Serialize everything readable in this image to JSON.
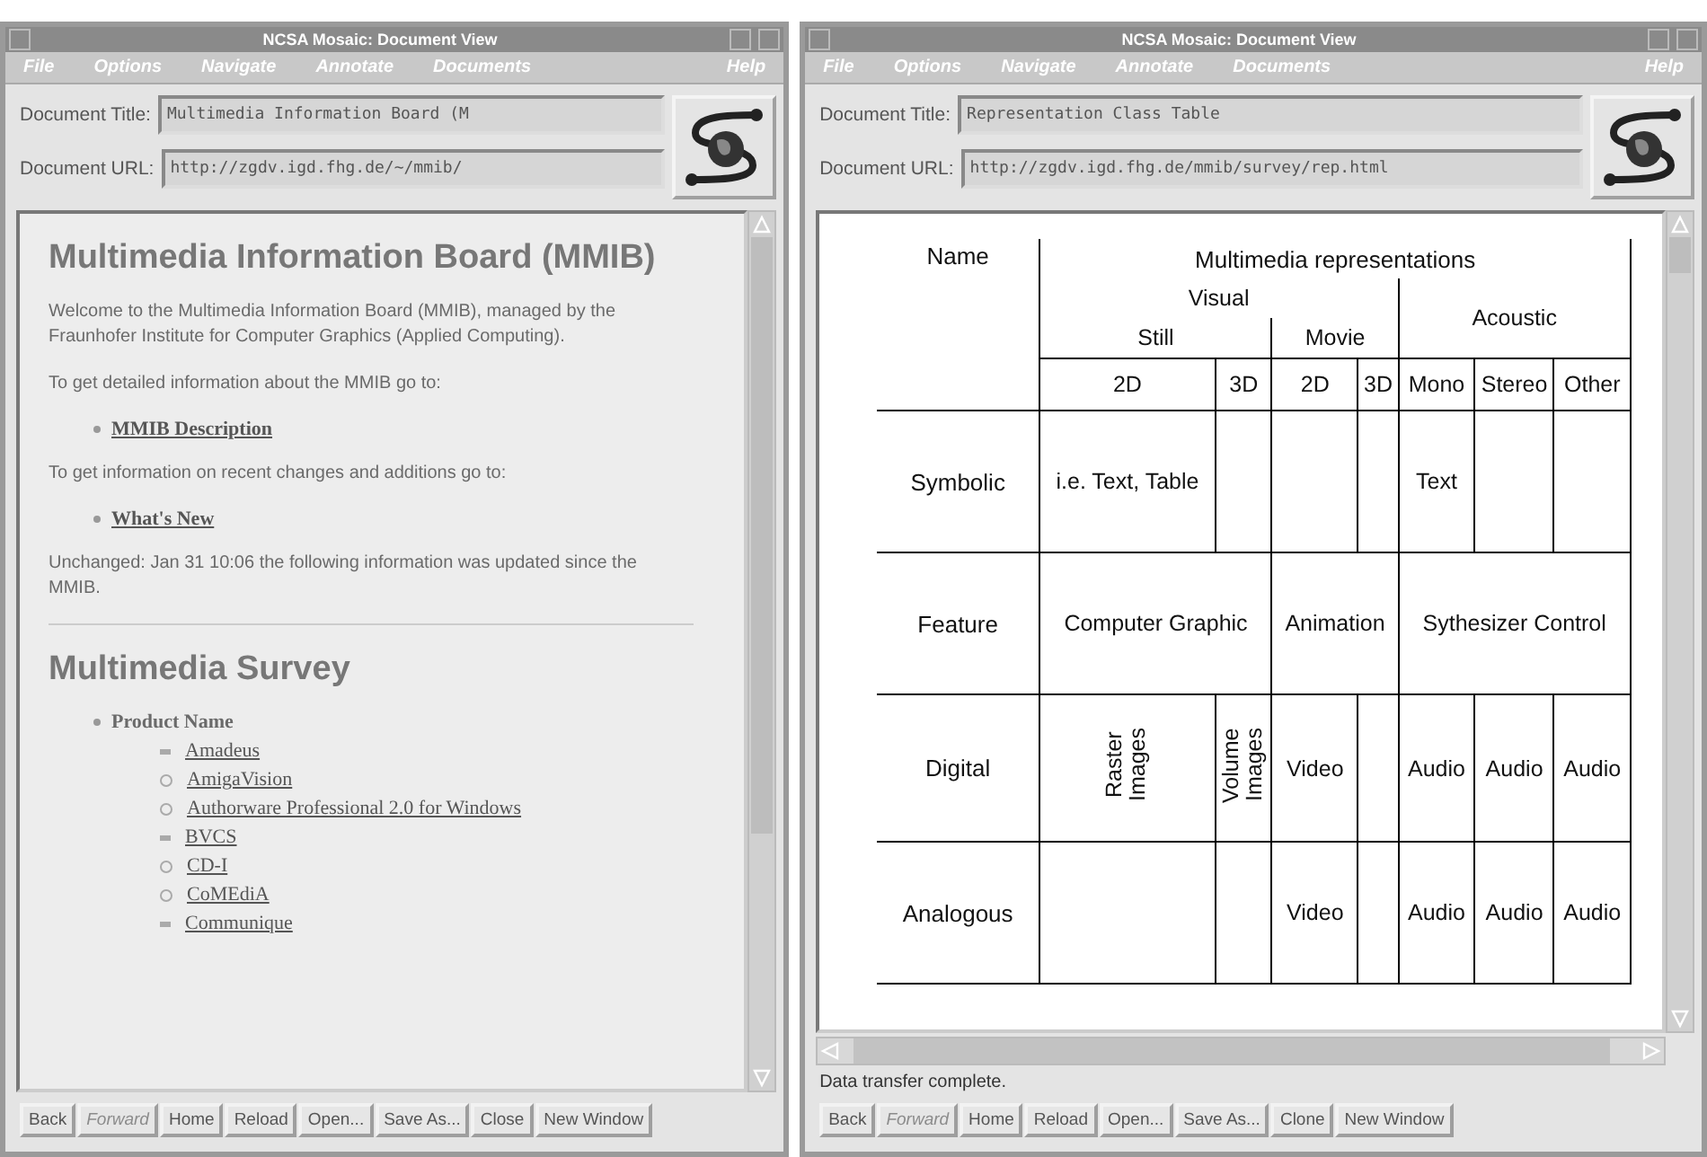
{
  "windows": [
    {
      "title": "NCSA Mosaic: Document View",
      "menu": [
        {
          "label": "File"
        },
        {
          "label": "Options"
        },
        {
          "label": "Navigate"
        },
        {
          "label": "Annotate"
        },
        {
          "label": "Documents"
        },
        {
          "label": "Help"
        }
      ],
      "title_label": "Document Title:",
      "document_title": "Multimedia Information Board (M",
      "url_label": "Document URL:",
      "document_url": "http://zgdv.igd.fhg.de/~/mmib/",
      "content": {
        "kind": "page",
        "heading": "Multimedia Information Board (MMIB)",
        "blocks": [
          {
            "kind": "para",
            "text": "Welcome to the Multimedia Information Board (MMIB), managed by the Fraunhofer Institute for Computer Graphics (Applied Computing)."
          },
          {
            "kind": "para",
            "text": "To get detailed information about the MMIB go to:"
          },
          {
            "kind": "link",
            "text": "MMIB Description"
          },
          {
            "kind": "para",
            "text": "To get information on recent changes and additions go to:"
          },
          {
            "kind": "link",
            "text": "What's New"
          },
          {
            "kind": "para",
            "text": "Unchanged: Jan 31 10:06 the following information was updated since the MMIB."
          },
          {
            "kind": "rule"
          },
          {
            "kind": "heading",
            "text": "Multimedia Survey"
          },
          {
            "kind": "list",
            "text": "Product Name",
            "items": [
              {
                "kind": "square",
                "text": "Amadeus"
              },
              {
                "kind": "circle",
                "text": "AmigaVision"
              },
              {
                "kind": "circle",
                "text": "Authorware Professional 2.0 for Windows"
              },
              {
                "kind": "square",
                "text": "BVCS"
              },
              {
                "kind": "circle",
                "text": "CD-I"
              },
              {
                "kind": "circle",
                "text": "CoMEdiA"
              },
              {
                "kind": "square",
                "text": "Communique"
              }
            ]
          }
        ]
      },
      "buttons": [
        {
          "label": "Back",
          "disabled": false
        },
        {
          "label": "Forward",
          "disabled": true
        },
        {
          "label": "Home",
          "disabled": false
        },
        {
          "label": "Reload",
          "disabled": false
        },
        {
          "label": "Open...",
          "disabled": false
        },
        {
          "label": "Save As...",
          "disabled": false
        },
        {
          "label": "Close",
          "disabled": false
        },
        {
          "label": "New Window",
          "disabled": false
        }
      ]
    },
    {
      "title": "NCSA Mosaic: Document View",
      "menu": [
        {
          "label": "File"
        },
        {
          "label": "Options"
        },
        {
          "label": "Navigate"
        },
        {
          "label": "Annotate"
        },
        {
          "label": "Documents"
        },
        {
          "label": "Help"
        }
      ],
      "title_label": "Document Title:",
      "document_title": "Representation Class Table",
      "url_label": "Document URL:",
      "document_url": "http://zgdv.igd.fhg.de/mmib/survey/rep.html",
      "content": {
        "kind": "table",
        "header": [
          [
            {
              "text": "Name",
              "rowspan": 4
            },
            {
              "text": "Multimedia representations",
              "colspan": 7
            }
          ],
          [
            {
              "text": "Visual",
              "colspan": 4
            },
            {
              "text": "Acoustic",
              "rowspan": 2,
              "colspan": 3
            }
          ],
          [
            {
              "text": "Still",
              "colspan": 2
            },
            {
              "text": "Movie",
              "colspan": 2
            }
          ],
          [
            {
              "text": "2D"
            },
            {
              "text": "3D"
            },
            {
              "text": "2D"
            },
            {
              "text": "3D"
            },
            {
              "text": "Mono"
            },
            {
              "text": "Stereo"
            },
            {
              "text": "Other"
            }
          ]
        ],
        "rows": [
          {
            "name": "Symbolic",
            "cells": [
              {
                "kind": "text",
                "text": "i.e. Text, Table"
              },
              {
                "kind": "empty"
              },
              {
                "kind": "empty"
              },
              {
                "kind": "empty"
              },
              {
                "kind": "text",
                "text": "Text"
              },
              {
                "kind": "empty"
              },
              {
                "kind": "empty"
              }
            ]
          },
          {
            "name": "Feature",
            "cells": [
              {
                "kind": "text",
                "text": "Computer Graphic",
                "colspan": 2
              },
              {
                "kind": "text",
                "text": "Animation",
                "colspan": 2
              },
              {
                "kind": "text",
                "text": "Sythesizer Control",
                "colspan": 3
              }
            ]
          },
          {
            "name": "Digital",
            "cells": [
              {
                "kind": "vertical",
                "text": "Raster Images"
              },
              {
                "kind": "vertical",
                "text": "Volume Images"
              },
              {
                "kind": "text",
                "text": "Video"
              },
              {
                "kind": "empty"
              },
              {
                "kind": "text",
                "text": "Audio"
              },
              {
                "kind": "text",
                "text": "Audio"
              },
              {
                "kind": "text",
                "text": "Audio"
              }
            ]
          },
          {
            "name": "Analogous",
            "cells": [
              {
                "kind": "empty"
              },
              {
                "kind": "empty"
              },
              {
                "kind": "text",
                "text": "Video"
              },
              {
                "kind": "empty"
              },
              {
                "kind": "text",
                "text": "Audio"
              },
              {
                "kind": "text",
                "text": "Audio"
              },
              {
                "kind": "text",
                "text": "Audio"
              }
            ]
          }
        ]
      },
      "status": "Data transfer complete.",
      "buttons": [
        {
          "label": "Back",
          "disabled": false
        },
        {
          "label": "Forward",
          "disabled": true
        },
        {
          "label": "Home",
          "disabled": false
        },
        {
          "label": "Reload",
          "disabled": false
        },
        {
          "label": "Open...",
          "disabled": false
        },
        {
          "label": "Save As...",
          "disabled": false
        },
        {
          "label": "Clone",
          "disabled": false
        },
        {
          "label": "New Window",
          "disabled": false
        }
      ]
    }
  ]
}
